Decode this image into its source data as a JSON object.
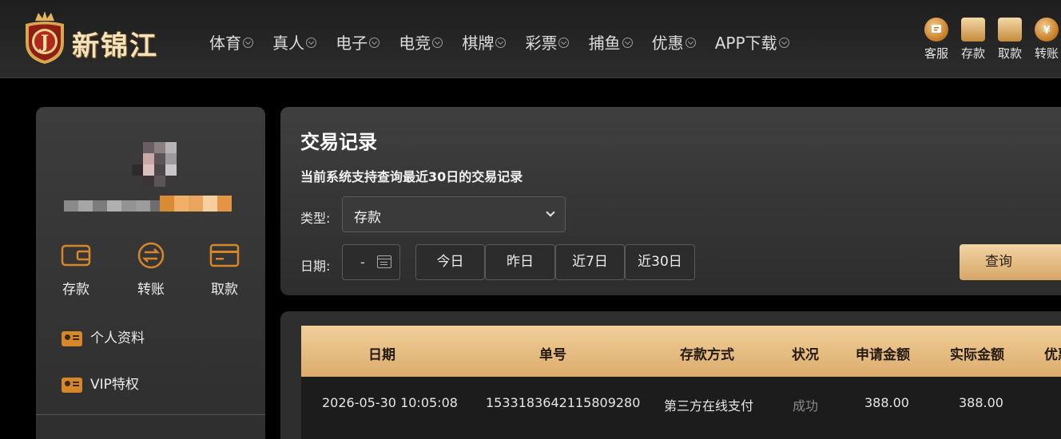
{
  "brand": {
    "name": "新锦江",
    "badge_letter": "J"
  },
  "nav": [
    "体育",
    "真人",
    "电子",
    "电竞",
    "棋牌",
    "彩票",
    "捕鱼",
    "优惠",
    "APP下载"
  ],
  "quick_actions": [
    "客服",
    "存款",
    "取款",
    "转账"
  ],
  "sidebar": {
    "actions": [
      "存款",
      "转账",
      "取款"
    ],
    "menu": [
      "个人资料",
      "VIP特权"
    ]
  },
  "panel": {
    "title": "交易记录",
    "subtitle": "当前系统支持查询最近30日的交易记录",
    "type_label": "类型:",
    "type_value": "存款",
    "date_label": "日期:",
    "date_value": "-",
    "ranges": [
      "今日",
      "昨日",
      "近7日",
      "近30日"
    ],
    "query_label": "查询"
  },
  "table": {
    "headers": [
      "日期",
      "单号",
      "存款方式",
      "状况",
      "申请金额",
      "实际金额",
      "优惠"
    ],
    "rows": [
      [
        "2026-05-30 10:05:08",
        "1533183642115809280",
        "第三方在线支付",
        "成功",
        "388.00",
        "388.00"
      ]
    ]
  },
  "colors": {
    "accent": "#dcac6c",
    "success_text": "#8a8a8a"
  }
}
